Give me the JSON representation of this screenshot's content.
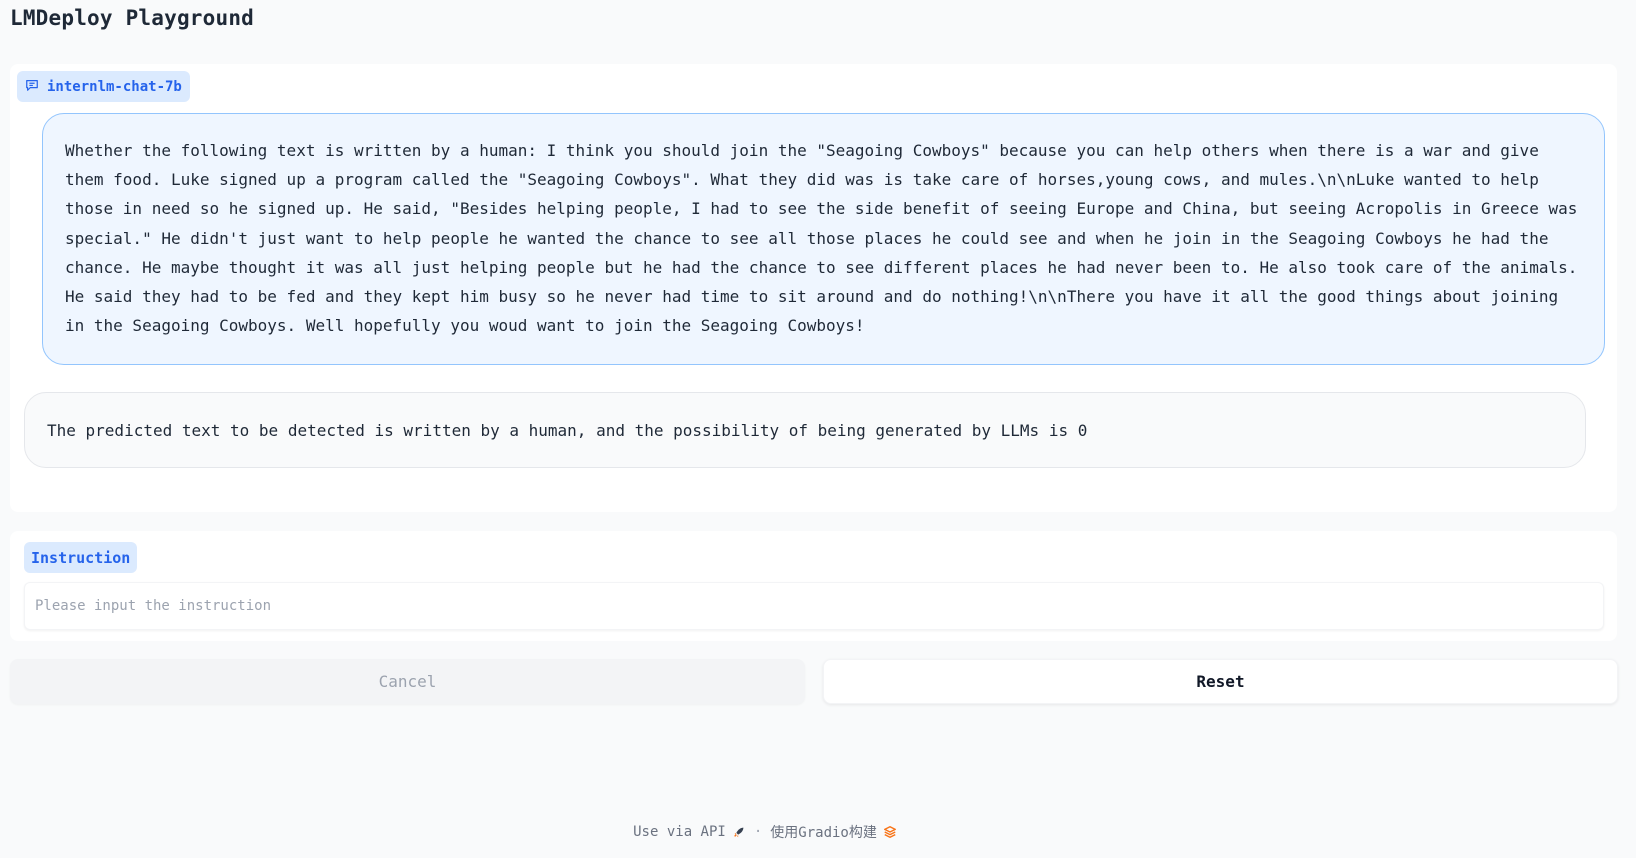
{
  "page": {
    "title": "LMDeploy Playground"
  },
  "chatbot": {
    "label": "internlm-chat-7b",
    "messages": [
      {
        "role": "user",
        "text": "Whether the following text is written by a human: I think you should join the \"Seagoing Cowboys\" because you can help others when there is a war and give them food. Luke signed up a program called the \"Seagoing Cowboys\". What they did was is take care of horses,young cows, and mules.\\n\\nLuke wanted to help those in need so he signed up. He said, \"Besides helping people, I had to see the side benefit of seeing Europe and China, but seeing Acropolis in Greece was special.\" He didn't just want to help people he wanted the chance to see all those places he could see and when he join in the Seagoing Cowboys he had the chance. He maybe thought it was all just helping people but he had the chance to see different places he had never been to. He also took care of the animals. He said they had to be fed and they kept him busy so he never had time to sit around and do nothing!\\n\\nThere you have it all the good things about joining in the Seagoing Cowboys. Well hopefully you woud want to join the Seagoing Cowboys!"
      },
      {
        "role": "bot",
        "text": "The predicted text to be detected is written by a human, and the possibility of being generated by LLMs is 0"
      }
    ]
  },
  "instruction": {
    "label": "Instruction",
    "value": "",
    "placeholder": "Please input the instruction"
  },
  "buttons": {
    "cancel_label": "Cancel",
    "reset_label": "Reset"
  },
  "footer": {
    "api_text": "Use via API",
    "separator": "·",
    "built_text": "使用Gradio构建"
  },
  "icons": {
    "chat_label_icon": "chat-bubble-icon",
    "api_icon": "rocket-icon",
    "gradio_icon": "gradio-logo-icon"
  },
  "colors": {
    "accent": "#2563eb",
    "label_bg": "#dbeafe",
    "user_bubble_bg": "#eff6ff",
    "user_bubble_border": "#93c5fd",
    "page_bg": "#f9fafb",
    "gradio_orange": "#f97316"
  }
}
